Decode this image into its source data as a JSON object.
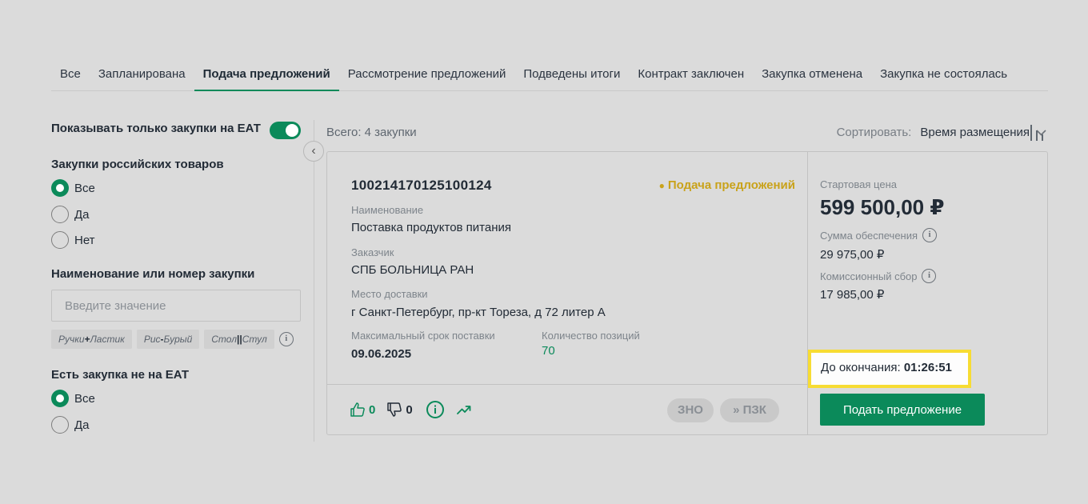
{
  "tabs": [
    {
      "label": "Все",
      "active": false
    },
    {
      "label": "Запланирована",
      "active": false
    },
    {
      "label": "Подача предложений",
      "active": true
    },
    {
      "label": "Рассмотрение предложений",
      "active": false
    },
    {
      "label": "Подведены итоги",
      "active": false
    },
    {
      "label": "Контракт заключен",
      "active": false
    },
    {
      "label": "Закупка отменена",
      "active": false
    },
    {
      "label": "Закупка не состоялась",
      "active": false
    }
  ],
  "sidebar": {
    "eat_only_label": "Показывать только закупки на ЕАТ",
    "eat_only_on": true,
    "russian_goods": {
      "heading": "Закупки российских товаров",
      "options": [
        {
          "label": "Все",
          "selected": true
        },
        {
          "label": "Да",
          "selected": false
        },
        {
          "label": "Нет",
          "selected": false
        }
      ]
    },
    "search": {
      "heading": "Наименование или номер закупки",
      "placeholder": "Введите значение",
      "value": "",
      "hints": [
        {
          "a": "Ручки",
          "op": "+",
          "b": "Ластик"
        },
        {
          "a": "Рис",
          "op": "-",
          "b": "Бурый"
        },
        {
          "a": "Стол",
          "op": "||",
          "b": "Стул"
        }
      ]
    },
    "non_eat": {
      "heading": "Есть закупка не на ЕАТ",
      "options": [
        {
          "label": "Все",
          "selected": true
        },
        {
          "label": "Да",
          "selected": false
        }
      ]
    }
  },
  "results": {
    "total": "Всего: 4 закупки",
    "sort_label": "Сортировать:",
    "sort_value": "Время размещения"
  },
  "card": {
    "number": "100214170125100124",
    "status": "Подача предложений",
    "name_label": "Наименование",
    "name": "Поставка продуктов питания",
    "customer_label": "Заказчик",
    "customer": "СПБ БОЛЬНИЦА РАН",
    "delivery_label": "Место доставки",
    "delivery": "г Санкт-Петербург, пр-кт Тореза, д 72 литер А",
    "max_term_label": "Максимальный срок поставки",
    "max_term": "09.06.2025",
    "positions_label": "Количество позиций",
    "positions": "70",
    "likes": "0",
    "dislikes": "0",
    "zno_label": "ЗНО",
    "pzk_label": "» ПЗК",
    "start_price_label": "Стартовая цена",
    "start_price": "599 500,00 ₽",
    "security_label": "Сумма обеспечения",
    "security": "29 975,00 ₽",
    "fee_label": "Комиссионный сбор",
    "fee": "17 985,00 ₽",
    "deadline_label": "До окончания:",
    "deadline": "01:26:51",
    "submit_label": "Подать предложение"
  },
  "colors": {
    "accent": "#0b8a5a",
    "status": "#c9a21a",
    "highlight": "#f7dc33",
    "background": "#dbdbdb"
  }
}
